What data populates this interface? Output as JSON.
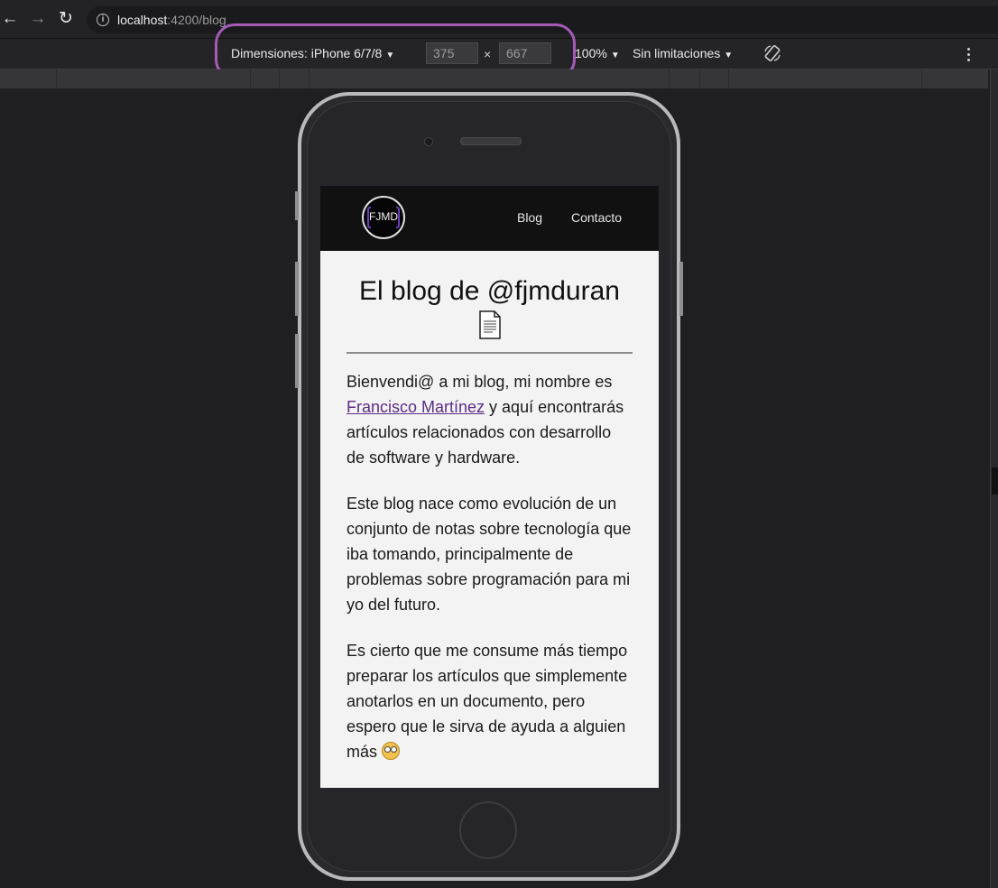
{
  "browser": {
    "url_host": "localhost",
    "url_path": ":4200/blog"
  },
  "device_toolbar": {
    "dimensions_label": "Dimensiones: iPhone 6/7/8",
    "width_value": "375",
    "times_sign": "×",
    "height_value": "667",
    "zoom_label": "100%",
    "throttle_label": "Sin limitaciones"
  },
  "site": {
    "logo_text": "FJMD",
    "nav": {
      "blog": "Blog",
      "contact": "Contacto"
    },
    "title": "El blog de @fjmduran",
    "paragraphs": {
      "p1_before": "Bienvendi@ a mi blog, mi nombre es ",
      "p1_link": "Francisco Martínez",
      "p1_after": " y aquí encontrarás artículos relacionados con desarrollo de software y hardware.",
      "p2": "Este blog nace como evolución de un conjunto de notas sobre tecnología que iba tomando, principalmente de problemas sobre programación para mi yo del futuro.",
      "p3": "Es cierto que me consume más tiempo preparar los artículos que simplemente anotarlos en un documento, pero espero que le sirva de ayuda a alguien más "
    }
  },
  "colors": {
    "highlight": "#a45bb8",
    "link": "#5b2d86",
    "header_bg": "#111111"
  }
}
